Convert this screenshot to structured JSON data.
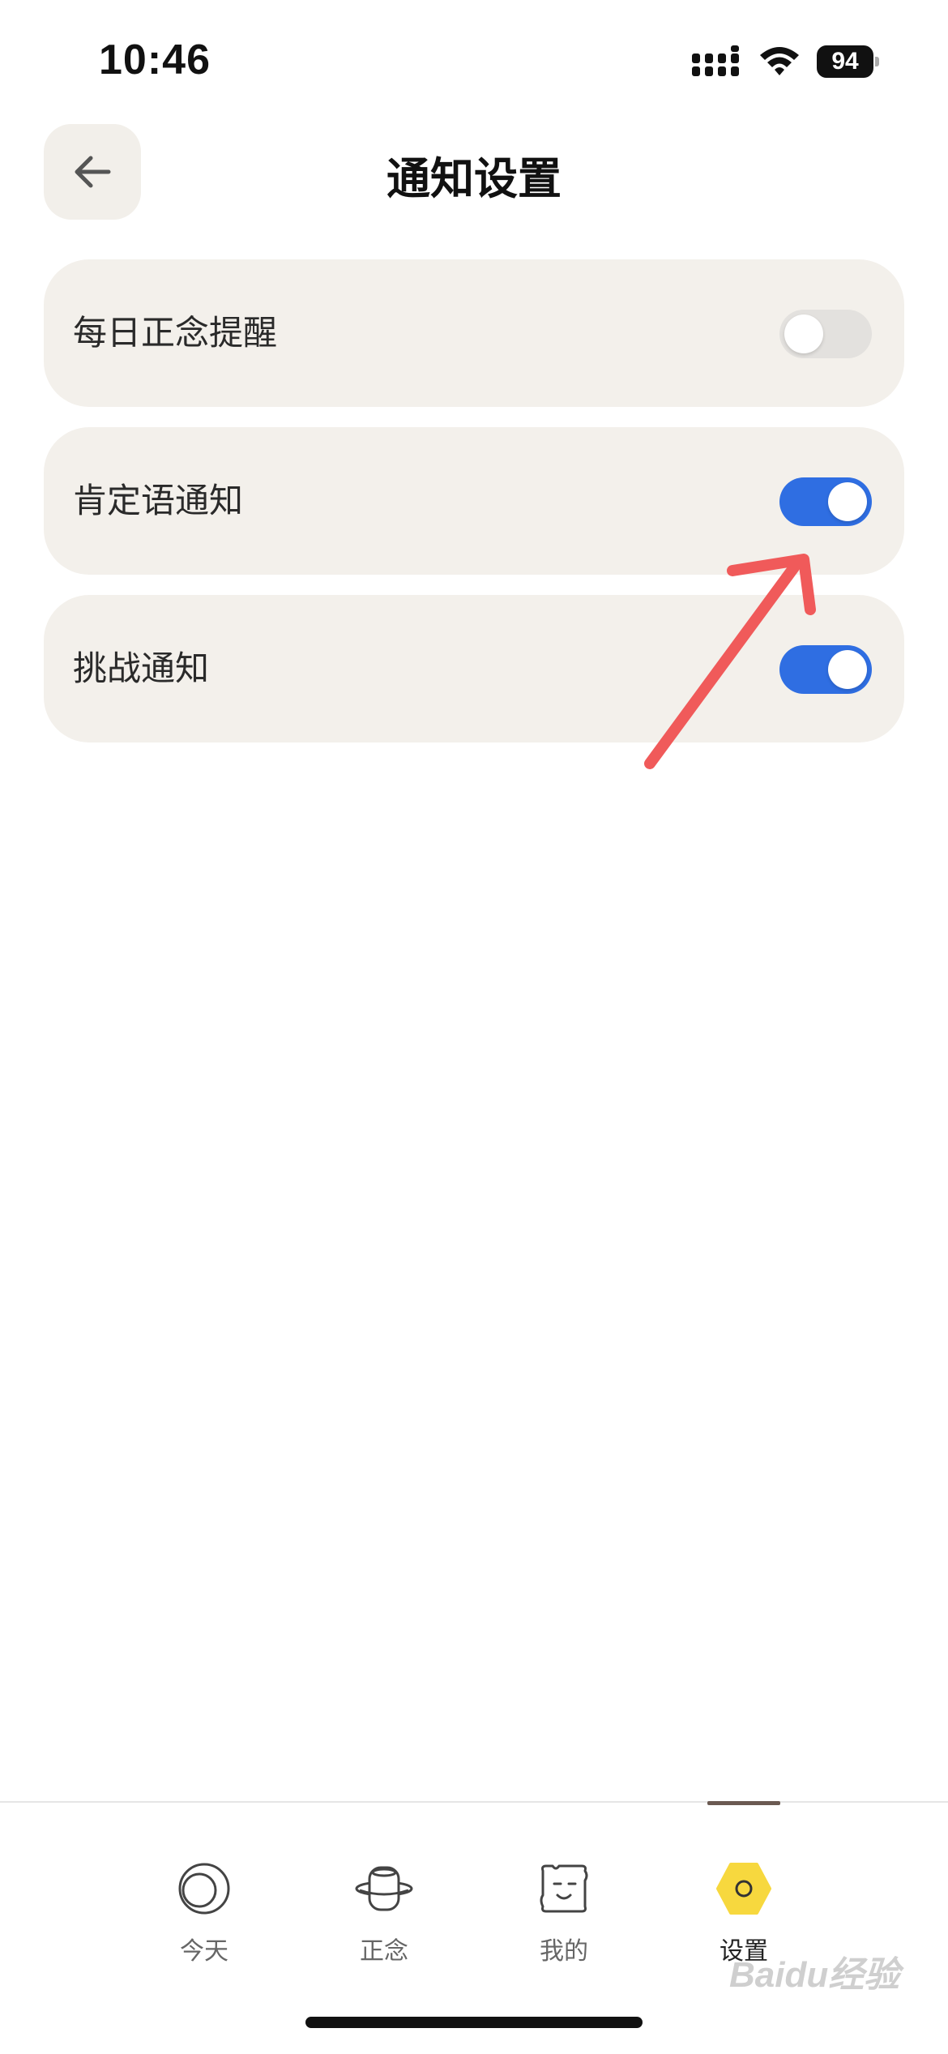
{
  "status_bar": {
    "time": "10:46",
    "battery": "94"
  },
  "header": {
    "title": "通知设置",
    "back_icon": "arrow-left-icon"
  },
  "settings": [
    {
      "label": "每日正念提醒",
      "enabled": false
    },
    {
      "label": "肯定语通知",
      "enabled": true
    },
    {
      "label": "挑战通知",
      "enabled": true
    }
  ],
  "tab_bar": {
    "tabs": [
      {
        "label": "今天",
        "icon": "moon-circle-icon",
        "active": false
      },
      {
        "label": "正念",
        "icon": "planet-icon",
        "active": false
      },
      {
        "label": "我的",
        "icon": "smiley-square-icon",
        "active": false
      },
      {
        "label": "设置",
        "icon": "hexagon-icon",
        "active": true
      }
    ]
  },
  "colors": {
    "toggle_on": "#2f6ee2",
    "row_background": "#f3f0eb",
    "active_tab_icon": "#f7d83e",
    "annotation": "#f05a5a"
  },
  "watermark": "Baidu经验"
}
